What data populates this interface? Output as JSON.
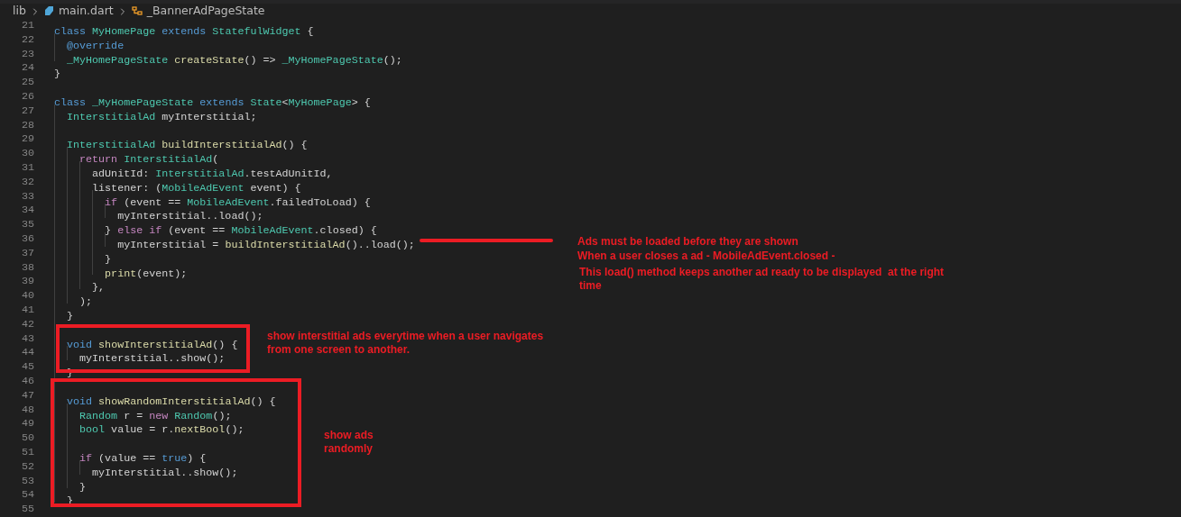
{
  "breadcrumb": {
    "folder": "lib",
    "file": "main.dart",
    "symbol": "_BannerAdPageState"
  },
  "lines": [
    {
      "number": "21",
      "tokens": [
        {
          "kind": "kw",
          "text": "class"
        },
        {
          "kind": "type",
          "text": " MyHomePage"
        },
        {
          "kind": "kw",
          "text": " extends"
        },
        {
          "kind": "type",
          "text": " StatefulWidget"
        },
        {
          "kind": "plain",
          "text": " {"
        }
      ]
    },
    {
      "number": "22",
      "tokens": [
        {
          "kind": "kw",
          "text": "  @override"
        }
      ]
    },
    {
      "number": "23",
      "tokens": [
        {
          "kind": "type",
          "text": "  _MyHomePageState"
        },
        {
          "kind": "fn",
          "text": " createState"
        },
        {
          "kind": "plain",
          "text": "() => "
        },
        {
          "kind": "type",
          "text": "_MyHomePageState"
        },
        {
          "kind": "plain",
          "text": "();"
        }
      ]
    },
    {
      "number": "24",
      "tokens": [
        {
          "kind": "plain",
          "text": "}"
        }
      ]
    },
    {
      "number": "25"
    },
    {
      "number": "26",
      "tokens": [
        {
          "kind": "kw",
          "text": "class"
        },
        {
          "kind": "type",
          "text": " _MyHomePageState"
        },
        {
          "kind": "kw",
          "text": " extends"
        },
        {
          "kind": "type",
          "text": " State"
        },
        {
          "kind": "plain",
          "text": "<"
        },
        {
          "kind": "type",
          "text": "MyHomePage"
        },
        {
          "kind": "plain",
          "text": "> {"
        }
      ]
    },
    {
      "number": "27",
      "tokens": [
        {
          "kind": "type",
          "text": "  InterstitialAd"
        },
        {
          "kind": "plain",
          "text": " myInterstitial;"
        }
      ]
    },
    {
      "number": "28"
    },
    {
      "number": "29",
      "tokens": [
        {
          "kind": "type",
          "text": "  InterstitialAd"
        },
        {
          "kind": "fn",
          "text": " buildInterstitialAd"
        },
        {
          "kind": "plain",
          "text": "() {"
        }
      ]
    },
    {
      "number": "30",
      "tokens": [
        {
          "kind": "ctrl",
          "text": "    return"
        },
        {
          "kind": "type",
          "text": " InterstitialAd"
        },
        {
          "kind": "plain",
          "text": "("
        }
      ]
    },
    {
      "number": "31",
      "tokens": [
        {
          "kind": "plain",
          "text": "      adUnitId: "
        },
        {
          "kind": "type",
          "text": "InterstitialAd"
        },
        {
          "kind": "plain",
          "text": ".testAdUnitId,"
        }
      ]
    },
    {
      "number": "32",
      "tokens": [
        {
          "kind": "plain",
          "text": "      listener: ("
        },
        {
          "kind": "type",
          "text": "MobileAdEvent"
        },
        {
          "kind": "plain",
          "text": " event) {"
        }
      ]
    },
    {
      "number": "33",
      "tokens": [
        {
          "kind": "ctrl",
          "text": "        if"
        },
        {
          "kind": "plain",
          "text": " (event == "
        },
        {
          "kind": "type",
          "text": "MobileAdEvent"
        },
        {
          "kind": "plain",
          "text": ".failedToLoad) {"
        }
      ]
    },
    {
      "number": "34",
      "tokens": [
        {
          "kind": "plain",
          "text": "          myInterstitial..load();"
        }
      ]
    },
    {
      "number": "35",
      "tokens": [
        {
          "kind": "plain",
          "text": "        } "
        },
        {
          "kind": "ctrl",
          "text": "else if"
        },
        {
          "kind": "plain",
          "text": " (event == "
        },
        {
          "kind": "type",
          "text": "MobileAdEvent"
        },
        {
          "kind": "plain",
          "text": ".closed) {"
        }
      ]
    },
    {
      "number": "36",
      "tokens": [
        {
          "kind": "plain",
          "text": "          myInterstitial = "
        },
        {
          "kind": "fn",
          "text": "buildInterstitialAd"
        },
        {
          "kind": "plain",
          "text": "()..load();"
        }
      ]
    },
    {
      "number": "37",
      "tokens": [
        {
          "kind": "plain",
          "text": "        }"
        }
      ]
    },
    {
      "number": "38",
      "tokens": [
        {
          "kind": "fn",
          "text": "        print"
        },
        {
          "kind": "plain",
          "text": "(event);"
        }
      ]
    },
    {
      "number": "39",
      "tokens": [
        {
          "kind": "plain",
          "text": "      },"
        }
      ]
    },
    {
      "number": "40",
      "tokens": [
        {
          "kind": "plain",
          "text": "    );"
        }
      ]
    },
    {
      "number": "41",
      "tokens": [
        {
          "kind": "plain",
          "text": "  }"
        }
      ]
    },
    {
      "number": "42"
    },
    {
      "number": "43",
      "tokens": [
        {
          "kind": "kw",
          "text": "  void"
        },
        {
          "kind": "fn",
          "text": " showInterstitialAd"
        },
        {
          "kind": "plain",
          "text": "() {"
        }
      ]
    },
    {
      "number": "44",
      "tokens": [
        {
          "kind": "plain",
          "text": "    myInterstitial..show();"
        }
      ]
    },
    {
      "number": "45",
      "tokens": [
        {
          "kind": "plain",
          "text": "  }"
        }
      ]
    },
    {
      "number": "46"
    },
    {
      "number": "47",
      "tokens": [
        {
          "kind": "kw",
          "text": "  void"
        },
        {
          "kind": "fn",
          "text": " showRandomInterstitialAd"
        },
        {
          "kind": "plain",
          "text": "() {"
        }
      ]
    },
    {
      "number": "48",
      "tokens": [
        {
          "kind": "type",
          "text": "    Random"
        },
        {
          "kind": "plain",
          "text": " r = "
        },
        {
          "kind": "ctrl",
          "text": "new"
        },
        {
          "kind": "type",
          "text": " Random"
        },
        {
          "kind": "plain",
          "text": "();"
        }
      ]
    },
    {
      "number": "49",
      "tokens": [
        {
          "kind": "type",
          "text": "    bool"
        },
        {
          "kind": "plain",
          "text": " value = r."
        },
        {
          "kind": "fn",
          "text": "nextBool"
        },
        {
          "kind": "plain",
          "text": "();"
        }
      ]
    },
    {
      "number": "50"
    },
    {
      "number": "51",
      "tokens": [
        {
          "kind": "ctrl",
          "text": "    if"
        },
        {
          "kind": "plain",
          "text": " (value == "
        },
        {
          "kind": "kw",
          "text": "true"
        },
        {
          "kind": "plain",
          "text": ") {"
        }
      ]
    },
    {
      "number": "52",
      "tokens": [
        {
          "kind": "plain",
          "text": "      myInterstitial..show();"
        }
      ]
    },
    {
      "number": "53",
      "tokens": [
        {
          "kind": "plain",
          "text": "    }"
        }
      ]
    },
    {
      "number": "54",
      "tokens": [
        {
          "kind": "plain",
          "text": "  }"
        }
      ]
    },
    {
      "number": "55"
    }
  ],
  "annotations": [
    {
      "text": "Ads must be loaded before they are shown"
    },
    {
      "text": "When a user closes a ad - MobileAdEvent.closed -"
    },
    {
      "text": "This load() method keeps another ad ready to be displayed  at the right time"
    },
    {
      "text": "show interstitial ads everytime when a user navigates from one screen to another."
    },
    {
      "text": "show ads randomly"
    }
  ]
}
